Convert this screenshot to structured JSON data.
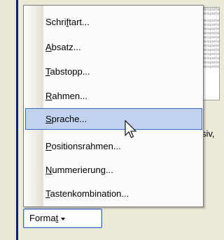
{
  "menu": {
    "items": [
      {
        "pre": "Schri",
        "key": "f",
        "post": "tart..."
      },
      {
        "pre": "",
        "key": "A",
        "post": "bsatz..."
      },
      {
        "pre": "",
        "key": "T",
        "post": "abstopp..."
      },
      {
        "pre": "",
        "key": "R",
        "post": "ahmen..."
      },
      {
        "pre": "",
        "key": "S",
        "post": "prache..."
      },
      {
        "pre": "",
        "key": "P",
        "post": "ositionsrahmen..."
      },
      {
        "pre": "",
        "key": "N",
        "post": "ummerierung..."
      },
      {
        "pre": "",
        "key": "T",
        "post": "astenkombination..."
      }
    ],
    "selected_index": 4
  },
  "format_button": {
    "pre": "Forma",
    "key": "t"
  },
  "background": {
    "partial_text": "siv,",
    "preview_lines": [
      "Beispieltext",
      "Beispieltext",
      "Beispieltext",
      "Beispieltext",
      "Beispieltext",
      "Beispieltext",
      "Beispieltext",
      "Beispieltext",
      "Beispieltext",
      "Beispieltext",
      "Beispieltext",
      "Beispieltext",
      "Beispieltext",
      "Beispieltext"
    ]
  },
  "colors": {
    "selection_fill": "#c1d2ee",
    "selection_border": "#316ac5",
    "dialog_border": "#0a246a"
  }
}
